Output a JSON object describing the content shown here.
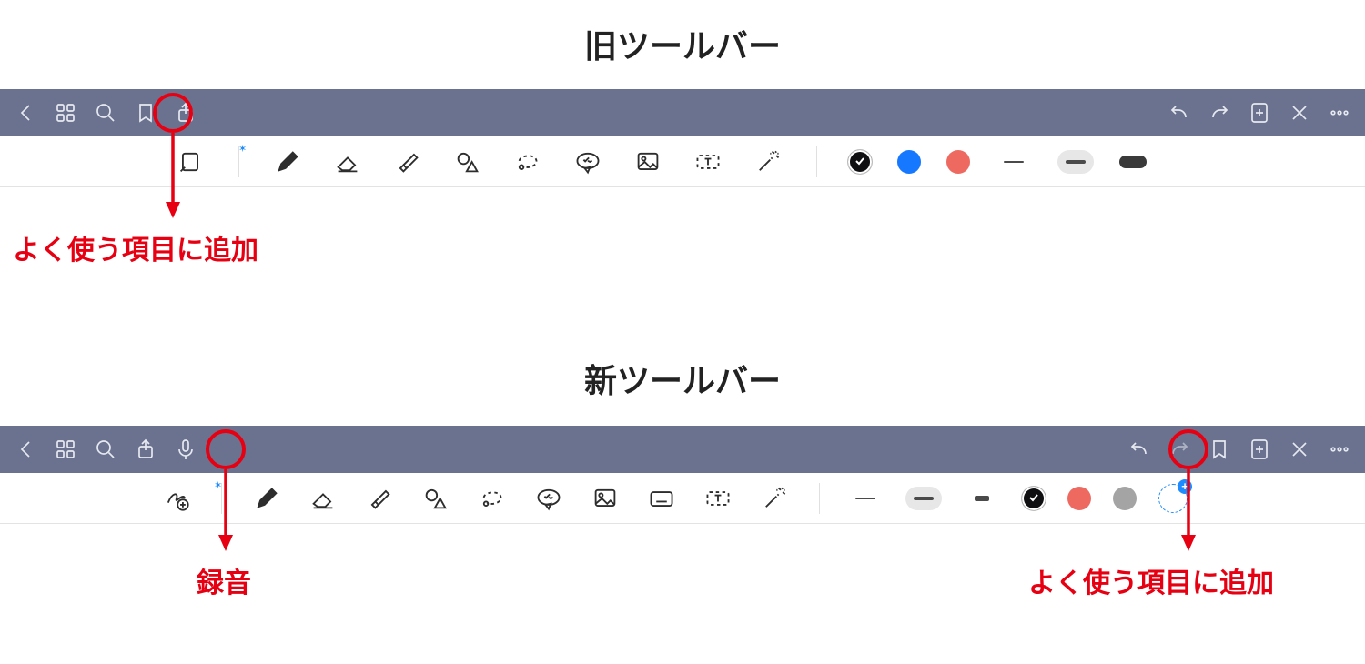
{
  "headings": {
    "old": "旧ツールバー",
    "new": "新ツールバー"
  },
  "annotations": {
    "old_bookmark": "よく使う項目に追加",
    "new_mic": "録音",
    "new_bookmark": "よく使う項目に追加"
  },
  "colors": {
    "topbar_bg": "#6a728f",
    "annotation": "#e60012",
    "black": "#0f0f12",
    "blue": "#1677ff",
    "red": "#ee6a61",
    "grey": "#a4a4a4",
    "accent_blue": "#1e8bff"
  },
  "old_toolbar": {
    "top_left": [
      "back-icon",
      "grid-icon",
      "search-icon",
      "bookmark-icon",
      "share-icon"
    ],
    "top_right": [
      "undo-icon",
      "redo-icon",
      "add-page-icon",
      "close-icon",
      "more-icon"
    ],
    "tools": [
      "readonly-icon",
      "pen-icon",
      "eraser-icon",
      "highlighter-icon",
      "shapes-icon",
      "lasso-icon",
      "sticker-icon",
      "image-icon",
      "textbox-icon",
      "laser-icon"
    ],
    "swatches": [
      {
        "name": "black",
        "hex": "#0f0f12",
        "selected": true
      },
      {
        "name": "blue",
        "hex": "#1677ff",
        "selected": false
      },
      {
        "name": "red",
        "hex": "#ee6a61",
        "selected": false
      }
    ],
    "strokes": [
      {
        "name": "thin",
        "selected": false
      },
      {
        "name": "med",
        "selected": true
      }
    ],
    "has_pill": true
  },
  "new_toolbar": {
    "top_left": [
      "back-icon",
      "grid-icon",
      "search-icon",
      "share-icon",
      "mic-icon"
    ],
    "top_right": [
      "undo-icon",
      "redo-icon",
      "bookmark-icon",
      "add-page-icon",
      "close-icon",
      "more-icon"
    ],
    "tools": [
      "scribble-add-icon",
      "pen-icon",
      "eraser-icon",
      "highlighter-icon",
      "shapes-icon",
      "lasso-icon",
      "sticker-icon",
      "image-icon",
      "keyboard-icon",
      "textbox-icon",
      "laser-icon"
    ],
    "strokes": [
      {
        "name": "thin",
        "selected": false
      },
      {
        "name": "med",
        "selected": true
      },
      {
        "name": "thick",
        "selected": false
      }
    ],
    "swatches": [
      {
        "name": "black",
        "hex": "#0f0f12",
        "selected": true
      },
      {
        "name": "red",
        "hex": "#ee6a61",
        "selected": false
      },
      {
        "name": "grey",
        "hex": "#a4a4a4",
        "selected": false
      }
    ],
    "has_add_swatch": true
  }
}
